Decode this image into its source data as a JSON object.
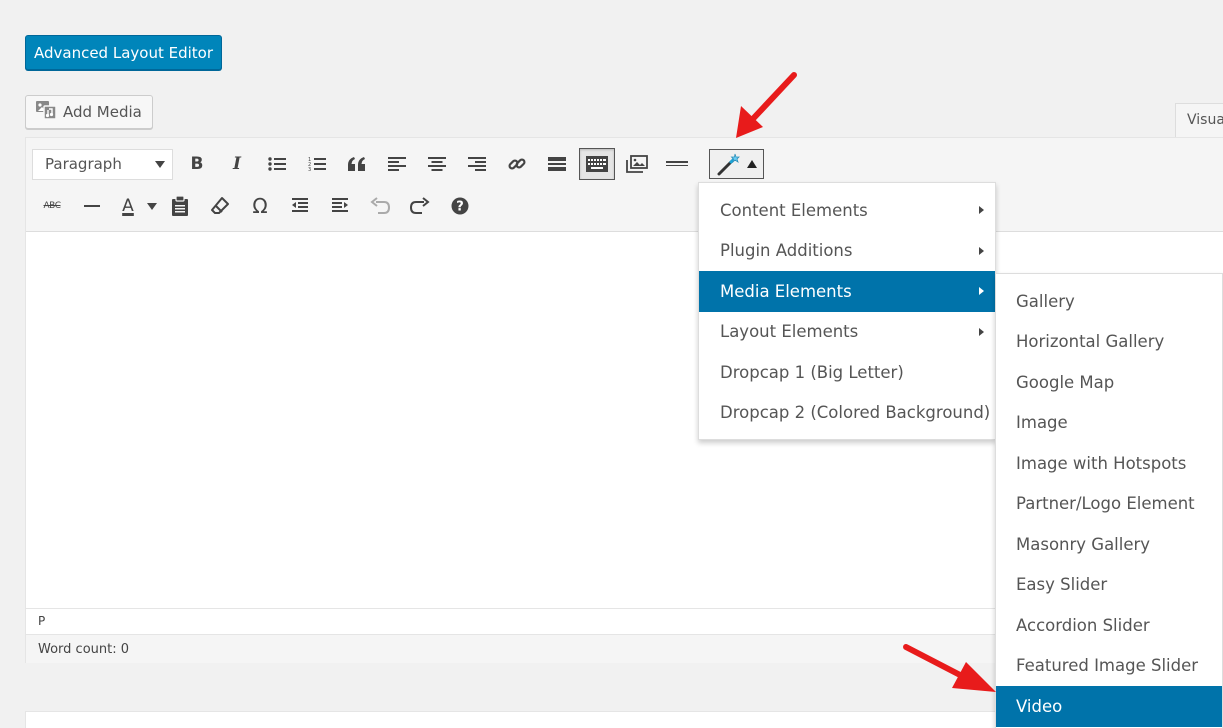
{
  "top_button": {
    "label": "Advanced Layout Editor"
  },
  "add_media": {
    "label": "Add Media"
  },
  "visual_tab": {
    "label": "Visual"
  },
  "toolbar": {
    "format_select": "Paragraph",
    "bold": "B",
    "italic": "I",
    "blockquote": "“",
    "strikethrough": "ABC",
    "text_color": "A",
    "special_char": "Ω",
    "help": "?"
  },
  "status": {
    "path": "P",
    "word_count": "Word count: 0"
  },
  "menu": {
    "items": [
      {
        "label": "Content Elements",
        "submenu": true
      },
      {
        "label": "Plugin Additions",
        "submenu": true
      },
      {
        "label": "Media Elements",
        "submenu": true,
        "selected": true
      },
      {
        "label": "Layout Elements",
        "submenu": true
      },
      {
        "label": "Dropcap 1 (Big Letter)",
        "submenu": false
      },
      {
        "label": "Dropcap 2 (Colored Background)",
        "submenu": false
      }
    ]
  },
  "submenu": {
    "items": [
      {
        "label": "Gallery"
      },
      {
        "label": "Horizontal Gallery"
      },
      {
        "label": "Google Map"
      },
      {
        "label": "Image"
      },
      {
        "label": "Image with Hotspots"
      },
      {
        "label": "Partner/Logo Element"
      },
      {
        "label": "Masonry Gallery"
      },
      {
        "label": "Easy Slider"
      },
      {
        "label": "Accordion Slider"
      },
      {
        "label": "Featured Image Slider"
      },
      {
        "label": "Video",
        "selected": true
      }
    ]
  },
  "colors": {
    "primary": "#0085ba",
    "selected": "#0073aa",
    "arrow": "#e81b1b"
  }
}
